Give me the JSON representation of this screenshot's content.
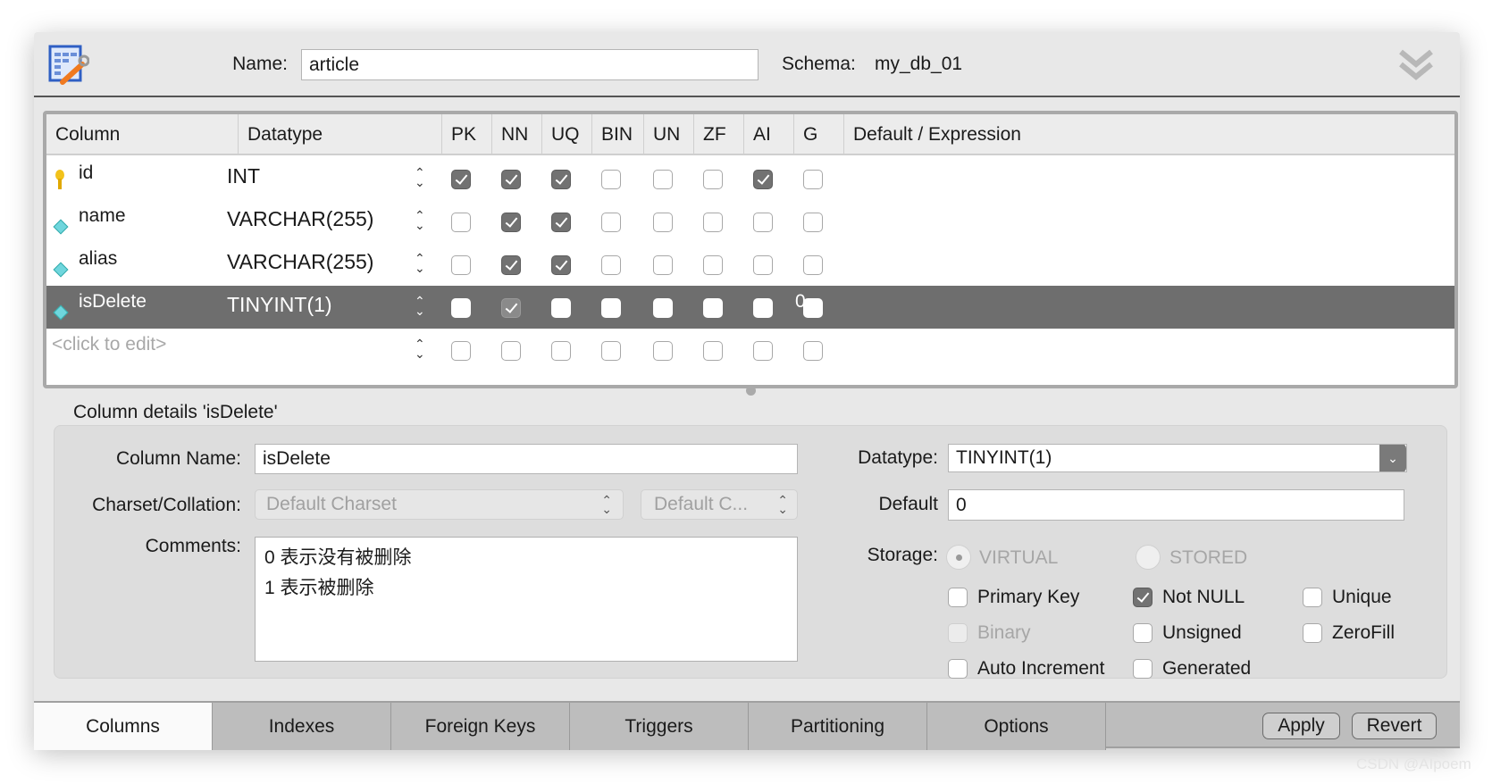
{
  "header": {
    "name_label": "Name:",
    "name_value": "article",
    "schema_label": "Schema:",
    "schema_value": "my_db_01",
    "table_icon": "table-edit-icon",
    "collapse_icon": "double-chevron-down-icon"
  },
  "grid": {
    "headers": [
      "Column",
      "Datatype",
      "PK",
      "NN",
      "UQ",
      "BIN",
      "UN",
      "ZF",
      "AI",
      "G",
      "Default / Expression"
    ],
    "rows": [
      {
        "name": "id",
        "icon": "key-icon",
        "datatype": "INT",
        "flags": [
          true,
          true,
          true,
          false,
          false,
          false,
          true,
          false
        ],
        "default": "",
        "selected": false
      },
      {
        "name": "name",
        "icon": "diamond-icon",
        "datatype": "VARCHAR(255)",
        "flags": [
          false,
          true,
          true,
          false,
          false,
          false,
          false,
          false
        ],
        "default": "",
        "selected": false
      },
      {
        "name": "alias",
        "icon": "diamond-icon",
        "datatype": "VARCHAR(255)",
        "flags": [
          false,
          true,
          true,
          false,
          false,
          false,
          false,
          false
        ],
        "default": "",
        "selected": false
      },
      {
        "name": "isDelete",
        "icon": "diamond-icon",
        "datatype": "TINYINT(1)",
        "flags": [
          false,
          true,
          false,
          false,
          false,
          false,
          false,
          false
        ],
        "default": "0",
        "selected": true
      }
    ],
    "placeholder_row": "<click to edit>"
  },
  "details": {
    "title": "Column details 'isDelete'",
    "column_name_label": "Column Name:",
    "column_name": "isDelete",
    "charset_label": "Charset/Collation:",
    "charset": "Default Charset",
    "collation": "Default C...",
    "comments_label": "Comments:",
    "comments_lines": [
      "0 表示没有被删除",
      "1 表示被删除"
    ],
    "datatype_label": "Datatype:",
    "datatype": "TINYINT(1)",
    "default_label": "Default",
    "default": "0",
    "storage_label": "Storage:",
    "storage_options": [
      "VIRTUAL",
      "STORED"
    ],
    "checkboxes": [
      {
        "label": "Primary Key",
        "checked": false,
        "disabled": false
      },
      {
        "label": "Not NULL",
        "checked": true,
        "disabled": false
      },
      {
        "label": "Unique",
        "checked": false,
        "disabled": false
      },
      {
        "label": "Binary",
        "checked": false,
        "disabled": true
      },
      {
        "label": "Unsigned",
        "checked": false,
        "disabled": false
      },
      {
        "label": "ZeroFill",
        "checked": false,
        "disabled": false
      },
      {
        "label": "Auto Increment",
        "checked": false,
        "disabled": false
      },
      {
        "label": "Generated",
        "checked": false,
        "disabled": false
      }
    ]
  },
  "tabs": [
    "Columns",
    "Indexes",
    "Foreign Keys",
    "Triggers",
    "Partitioning",
    "Options"
  ],
  "active_tab": "Columns",
  "buttons": {
    "apply": "Apply",
    "revert": "Revert"
  },
  "watermark": "CSDN @AIpoem"
}
